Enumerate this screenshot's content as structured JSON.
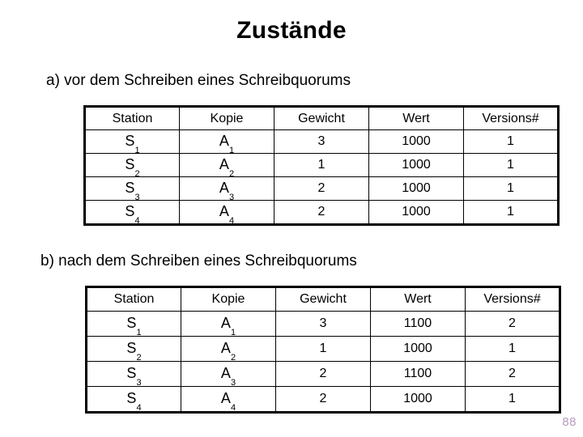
{
  "slide": {
    "title": "Zustände",
    "page_number": "88",
    "page_number_color": "#b89cc0"
  },
  "sections": [
    {
      "caption": "a) vor dem Schreiben eines Schreibquorums",
      "table": {
        "headers": [
          "Station",
          "Kopie",
          "Gewicht",
          "Wert",
          "Versions#"
        ],
        "rows": [
          {
            "station": "S",
            "station_sub": "1",
            "kopie": "A",
            "kopie_sub": "1",
            "gewicht": "3",
            "wert": "1000",
            "version": "1"
          },
          {
            "station": "S",
            "station_sub": "2",
            "kopie": "A",
            "kopie_sub": "2",
            "gewicht": "1",
            "wert": "1000",
            "version": "1"
          },
          {
            "station": "S",
            "station_sub": "3",
            "kopie": "A",
            "kopie_sub": "3",
            "gewicht": "2",
            "wert": "1000",
            "version": "1"
          },
          {
            "station": "S",
            "station_sub": "4",
            "kopie": "A",
            "kopie_sub": "4",
            "gewicht": "2",
            "wert": "1000",
            "version": "1"
          }
        ]
      }
    },
    {
      "caption": "b) nach dem Schreiben eines Schreibquorums",
      "table": {
        "headers": [
          "Station",
          "Kopie",
          "Gewicht",
          "Wert",
          "Versions#"
        ],
        "rows": [
          {
            "station": "S",
            "station_sub": "1",
            "kopie": "A",
            "kopie_sub": "1",
            "gewicht": "3",
            "wert": "1100",
            "version": "2"
          },
          {
            "station": "S",
            "station_sub": "2",
            "kopie": "A",
            "kopie_sub": "2",
            "gewicht": "1",
            "wert": "1000",
            "version": "1"
          },
          {
            "station": "S",
            "station_sub": "3",
            "kopie": "A",
            "kopie_sub": "3",
            "gewicht": "2",
            "wert": "1100",
            "version": "2"
          },
          {
            "station": "S",
            "station_sub": "4",
            "kopie": "A",
            "kopie_sub": "4",
            "gewicht": "2",
            "wert": "1000",
            "version": "1"
          }
        ]
      }
    }
  ]
}
